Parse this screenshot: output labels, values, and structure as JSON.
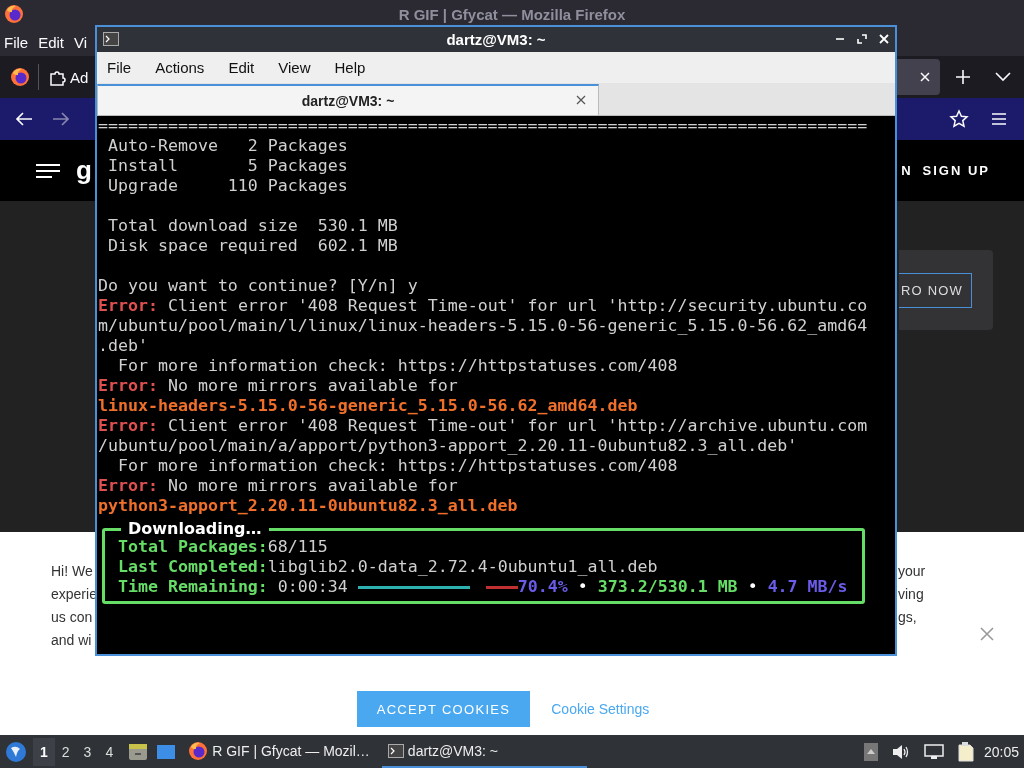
{
  "browser": {
    "title": "R GIF | Gfycat — Mozilla Firefox",
    "menu": [
      "File",
      "Edit",
      "Vi"
    ],
    "tab_label": "Ad",
    "header": {
      "logo_fragment": "g",
      "login_fragment": "N",
      "signup": "SIGN UP"
    },
    "promo_button": "RO NOW",
    "cookie_banner": {
      "left_fragments": [
        "Hi! We",
        "experie",
        "us con",
        "and wi"
      ],
      "right_fragments": [
        "your",
        "ving",
        "gs,"
      ],
      "accept": "ACCEPT COOKIES",
      "settings": "Cookie Settings"
    }
  },
  "terminal": {
    "title": "dartz@VM3: ~",
    "menu": [
      "File",
      "Actions",
      "Edit",
      "View",
      "Help"
    ],
    "tabs": [
      {
        "label": "dartz@VM3: ~",
        "selected": true
      }
    ],
    "lines": [
      {
        "kind": "text",
        "spans": [
          {
            "kind": "plain",
            "text": "============================================================================="
          }
        ]
      },
      {
        "kind": "text",
        "spans": [
          {
            "kind": "plain",
            "text": " Auto-Remove   2 Packages"
          }
        ]
      },
      {
        "kind": "text",
        "spans": [
          {
            "kind": "plain",
            "text": " Install       5 Packages"
          }
        ]
      },
      {
        "kind": "text",
        "spans": [
          {
            "kind": "plain",
            "text": " Upgrade     110 Packages"
          }
        ]
      },
      {
        "kind": "blank"
      },
      {
        "kind": "text",
        "spans": [
          {
            "kind": "plain",
            "text": " Total download size  530.1 MB"
          }
        ]
      },
      {
        "kind": "text",
        "spans": [
          {
            "kind": "plain",
            "text": " Disk space required  602.1 MB"
          }
        ]
      },
      {
        "kind": "blank"
      },
      {
        "kind": "text",
        "spans": [
          {
            "kind": "plain",
            "text": "Do you want to continue? [Y/n] y"
          }
        ]
      },
      {
        "kind": "text",
        "spans": [
          {
            "kind": "error",
            "text": "Error:"
          },
          {
            "kind": "plain",
            "text": " Client error '408 Request Time-out' for url 'http://security.ubuntu.co"
          }
        ]
      },
      {
        "kind": "text",
        "spans": [
          {
            "kind": "plain",
            "text": "m/ubuntu/pool/main/l/linux/linux-headers-5.15.0-56-generic_5.15.0-56.62_amd64"
          }
        ]
      },
      {
        "kind": "text",
        "spans": [
          {
            "kind": "plain",
            "text": ".deb'"
          }
        ]
      },
      {
        "kind": "text",
        "spans": [
          {
            "kind": "plain",
            "text": "  For more information check: https://httpstatuses.com/408"
          }
        ]
      },
      {
        "kind": "text",
        "spans": [
          {
            "kind": "error",
            "text": "Error:"
          },
          {
            "kind": "plain",
            "text": " No more mirrors available for"
          }
        ]
      },
      {
        "kind": "text",
        "spans": [
          {
            "kind": "file",
            "text": "linux-headers-5.15.0-56-generic_5.15.0-56.62_amd64.deb"
          }
        ]
      },
      {
        "kind": "text",
        "spans": [
          {
            "kind": "error",
            "text": "Error:"
          },
          {
            "kind": "plain",
            "text": " Client error '408 Request Time-out' for url 'http://archive.ubuntu.com"
          }
        ]
      },
      {
        "kind": "text",
        "spans": [
          {
            "kind": "plain",
            "text": "/ubuntu/pool/main/a/apport/python3-apport_2.20.11-0ubuntu82.3_all.deb'"
          }
        ]
      },
      {
        "kind": "text",
        "spans": [
          {
            "kind": "plain",
            "text": "  For more information check: https://httpstatuses.com/408"
          }
        ]
      },
      {
        "kind": "text",
        "spans": [
          {
            "kind": "error",
            "text": "Error:"
          },
          {
            "kind": "plain",
            "text": " No more mirrors available for"
          }
        ]
      },
      {
        "kind": "text",
        "spans": [
          {
            "kind": "file",
            "text": "python3-apport_2.20.11-0ubuntu82.3_all.deb"
          }
        ]
      }
    ],
    "progress": {
      "title": "Downloading…",
      "rows": [
        {
          "label": "Total Packages:",
          "value": "68/115"
        },
        {
          "label": "Last Completed:",
          "value": "libglib2.0-data_2.72.4-0ubuntu1_all.deb"
        }
      ],
      "status": [
        {
          "kind": "label",
          "text": "Time Remaining:"
        },
        {
          "kind": "value",
          "text": "0:00:34"
        },
        {
          "kind": "bar",
          "level": 0.704
        },
        {
          "kind": "percent",
          "text": "70.4%"
        },
        {
          "kind": "sep",
          "text": "•"
        },
        {
          "kind": "size",
          "text": "373.2/530.1 MB"
        },
        {
          "kind": "sep",
          "text": "•"
        },
        {
          "kind": "speed",
          "text": "4.7 MB/s"
        }
      ]
    }
  },
  "taskbar": {
    "workspaces": [
      {
        "label": "1",
        "selected": true
      },
      {
        "label": "2",
        "selected": false
      },
      {
        "label": "3",
        "selected": false
      },
      {
        "label": "4",
        "selected": false
      }
    ],
    "tasks": [
      {
        "kind": "browser",
        "label": "R GIF | Gfycat — Mozil…",
        "selected": false
      },
      {
        "kind": "terminal",
        "label": "dartz@VM3: ~",
        "selected": true
      }
    ],
    "clock": "20:05"
  }
}
